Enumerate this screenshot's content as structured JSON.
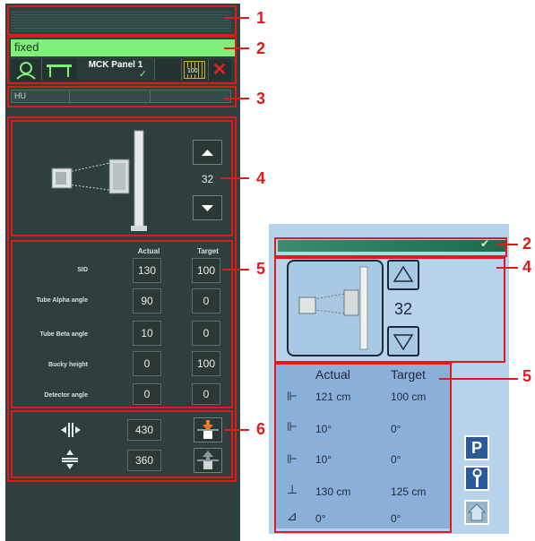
{
  "left_panel": {
    "mode_text": "fixed",
    "panel_name": "MCK Panel 1",
    "check_glyph": "✓",
    "grid_number": "100",
    "close_glyph": "✕",
    "hu_label": "HU",
    "position_value": "32",
    "table": {
      "header_actual": "Actual",
      "header_target": "Target",
      "rows": [
        {
          "label": "SID",
          "actual": "130",
          "target": "100"
        },
        {
          "label": "Tube Alpha angle",
          "actual": "90",
          "target": "0"
        },
        {
          "label": "Tube Beta angle",
          "actual": "10",
          "target": "0"
        },
        {
          "label": "Bucky height",
          "actual": "0",
          "target": "100"
        },
        {
          "label": "Detector angle",
          "actual": "0",
          "target": "0"
        }
      ]
    },
    "dims": {
      "width_value": "430",
      "height_value": "360"
    }
  },
  "callouts": {
    "left": [
      "1",
      "2",
      "3",
      "4",
      "5",
      "6"
    ],
    "right": [
      "2",
      "4",
      "5"
    ]
  },
  "right_panel": {
    "check_glyph": "✔",
    "position_value": "32",
    "header_actual": "Actual",
    "header_target": "Target",
    "rows": [
      {
        "actual": "121 cm",
        "target": "100 cm"
      },
      {
        "actual": "10°",
        "target": "0°"
      },
      {
        "actual": "10°",
        "target": "0°"
      },
      {
        "actual": "130 cm",
        "target": "125 cm"
      },
      {
        "actual": "0°",
        "target": "0°"
      }
    ],
    "buttons": {
      "park_label": "P"
    }
  },
  "colors": {
    "dark_panel": "#2f3f3d",
    "fixed_green": "#7ef07a",
    "callout_red": "#e01919",
    "right_bg": "#b7d3eb",
    "table_blue": "#8ab0da",
    "close_red": "#e02020",
    "orange_arrow": "#f07a20"
  }
}
